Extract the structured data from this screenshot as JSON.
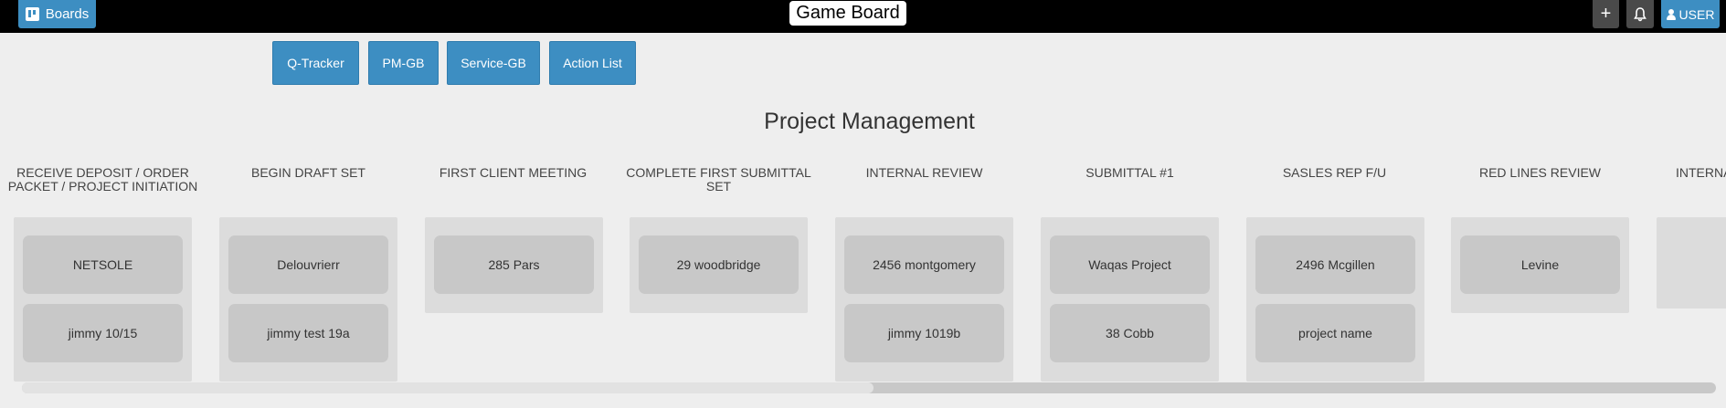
{
  "header": {
    "boards_label": "Boards",
    "app_title": "Game Board",
    "add_label": "+",
    "user_label": "USER"
  },
  "nav": {
    "buttons": [
      "Q-Tracker",
      "PM-GB",
      "Service-GB",
      "Action List"
    ]
  },
  "board": {
    "title": "Project Management",
    "columns": [
      {
        "header": "RECEIVE DEPOSIT / ORDER PACKET / PROJECT INITIATION",
        "cards": [
          "NETSOLE",
          "jimmy 10/15"
        ]
      },
      {
        "header": "BEGIN DRAFT SET",
        "cards": [
          "Delouvrierr",
          "jimmy test 19a"
        ]
      },
      {
        "header": "FIRST CLIENT MEETING",
        "cards": [
          "285 Pars"
        ]
      },
      {
        "header": "COMPLETE FIRST SUBMITTAL SET",
        "cards": [
          "29 woodbridge"
        ]
      },
      {
        "header": "INTERNAL REVIEW",
        "cards": [
          "2456 montgomery",
          "jimmy 1019b"
        ]
      },
      {
        "header": "SUBMITTAL #1",
        "cards": [
          "Waqas Project",
          "38 Cobb"
        ]
      },
      {
        "header": "SASLES REP F/U",
        "cards": [
          "2496 Mcgillen",
          "project name"
        ]
      },
      {
        "header": "RED LINES REVIEW",
        "cards": [
          "Levine"
        ]
      },
      {
        "header": "INTERNAL R",
        "cards": []
      }
    ]
  },
  "scrollbar": {
    "horizontal_position": 0.5
  }
}
